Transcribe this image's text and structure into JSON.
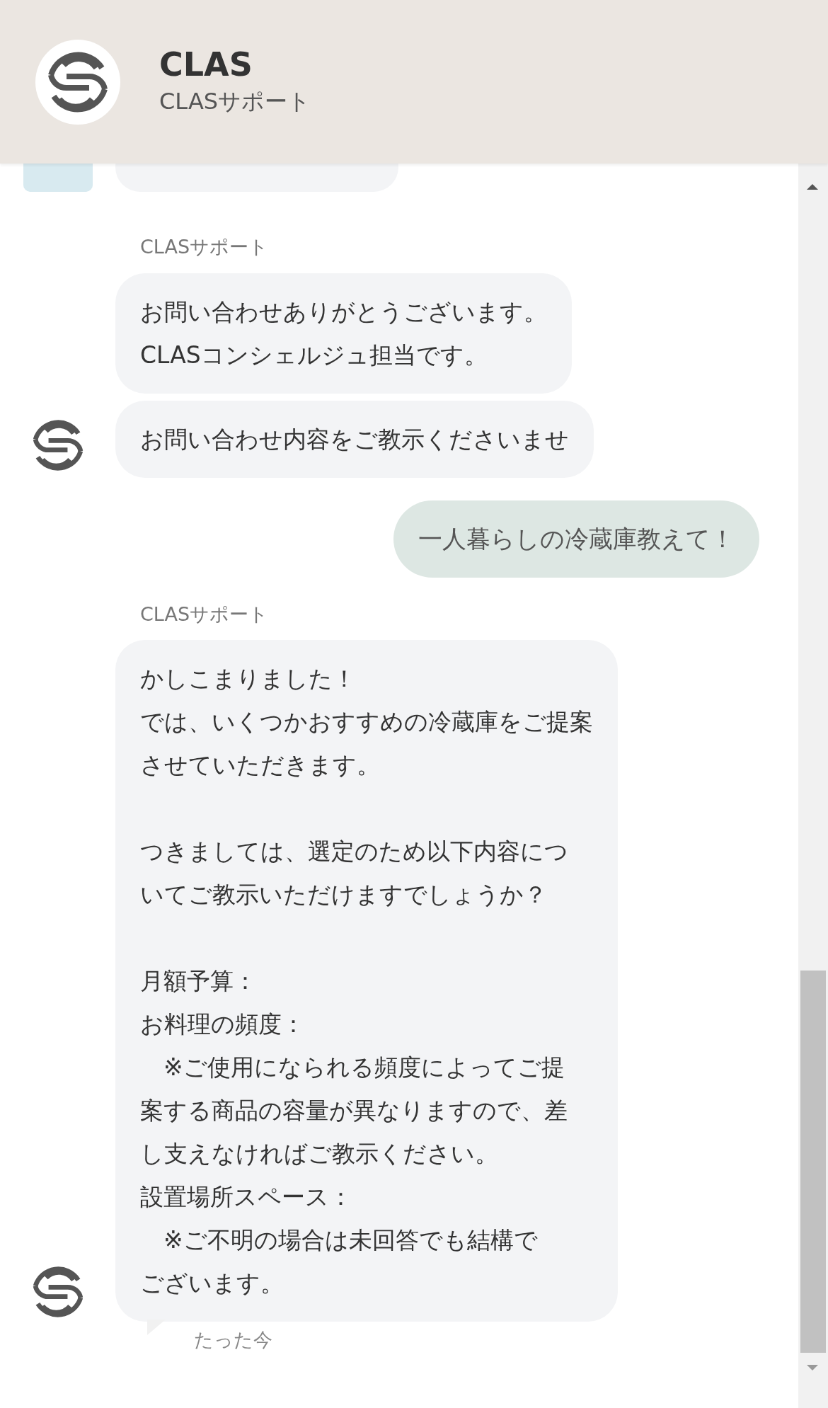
{
  "header": {
    "title": "CLAS",
    "subtitle": "CLASサポート"
  },
  "messages": [
    {
      "kind": "bot"
    },
    {
      "kind": "agent",
      "sender": "CLASサポート",
      "bubbles": [
        [
          [
            "お問い合わせありがとうございます。",
            "CLASコンシェルジュ担当です。"
          ]
        ],
        [
          [
            "お問い合わせ内容をご教示くださいませ"
          ]
        ]
      ]
    },
    {
      "kind": "user",
      "bubbles": [
        [
          [
            "一人暮らしの冷蔵庫教えて！"
          ]
        ]
      ]
    },
    {
      "kind": "agent",
      "sender": "CLASサポート",
      "bubbles": [
        [
          [
            "かしこまりました！",
            "では、いくつかおすすめの冷蔵庫をご提案",
            "させていただきます。"
          ],
          [
            "つきましては、選定のため以下内容につ",
            "いてご教示いただけますでしょうか？"
          ],
          [
            "月額予算：",
            "お料理の頻度：",
            "　※ご使用になられる頻度によってご提",
            "案する商品の容量が異なりますので、差",
            "し支えなければご教示ください。",
            "設置場所スペース：",
            "　※ご不明の場合は未回答でも結構で",
            "ございます。"
          ]
        ]
      ],
      "time": "たった今"
    }
  ]
}
